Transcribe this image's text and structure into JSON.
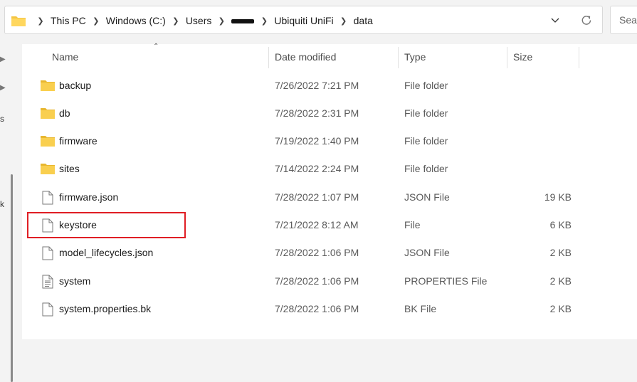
{
  "address_bar": {
    "breadcrumbs": [
      "This PC",
      "Windows (C:)",
      "Users",
      "Ubiquiti UniFi",
      "data"
    ]
  },
  "search": {
    "placeholder": "Search"
  },
  "columns": {
    "name": "Name",
    "date": "Date modified",
    "type": "Type",
    "size": "Size"
  },
  "files": [
    {
      "name": "backup",
      "date": "7/26/2022 7:21 PM",
      "type": "File folder",
      "size": "",
      "icon": "folder-icon"
    },
    {
      "name": "db",
      "date": "7/28/2022 2:31 PM",
      "type": "File folder",
      "size": "",
      "icon": "folder-icon"
    },
    {
      "name": "firmware",
      "date": "7/19/2022 1:40 PM",
      "type": "File folder",
      "size": "",
      "icon": "folder-icon"
    },
    {
      "name": "sites",
      "date": "7/14/2022 2:24 PM",
      "type": "File folder",
      "size": "",
      "icon": "folder-icon"
    },
    {
      "name": "firmware.json",
      "date": "7/28/2022 1:07 PM",
      "type": "JSON File",
      "size": "19 KB",
      "icon": "file-icon"
    },
    {
      "name": "keystore",
      "date": "7/21/2022 8:12 AM",
      "type": "File",
      "size": "6 KB",
      "icon": "file-icon"
    },
    {
      "name": "model_lifecycles.json",
      "date": "7/28/2022 1:06 PM",
      "type": "JSON File",
      "size": "2 KB",
      "icon": "file-icon"
    },
    {
      "name": "system",
      "date": "7/28/2022 1:06 PM",
      "type": "PROPERTIES File",
      "size": "2 KB",
      "icon": "properties-file-icon"
    },
    {
      "name": "system.properties.bk",
      "date": "7/28/2022 1:06 PM",
      "type": "BK File",
      "size": "2 KB",
      "icon": "file-icon"
    }
  ],
  "nav_fragments": [
    "s",
    "k"
  ],
  "colors": {
    "folder": "#f4c542",
    "highlight": "#e01e24",
    "background": "#f3f3f3"
  }
}
